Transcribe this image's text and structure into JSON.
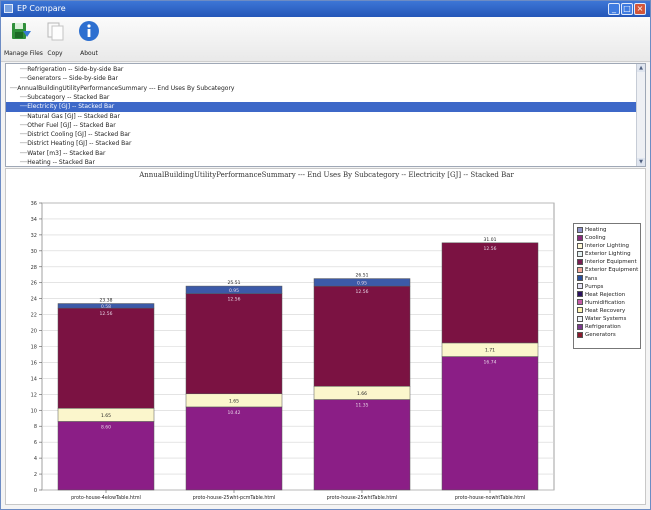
{
  "window": {
    "title": "EP Compare"
  },
  "toolbar": {
    "items": [
      {
        "label": "Manage Files",
        "icon": "manage-files-icon"
      },
      {
        "label": "Copy",
        "icon": "copy-icon"
      },
      {
        "label": "About",
        "icon": "info-icon"
      }
    ]
  },
  "tree": {
    "items": [
      {
        "text": "Refrigeration -- Side-by-side Bar",
        "indent": 2,
        "state": "normal"
      },
      {
        "text": "Generators -- Side-by-side Bar",
        "indent": 2,
        "state": "normal"
      },
      {
        "text": "AnnualBuildingUtilityPerformanceSummary --- End Uses By Subcategory",
        "indent": 1,
        "state": "normal"
      },
      {
        "text": "Subcategory -- Stacked Bar",
        "indent": 2,
        "state": "normal"
      },
      {
        "text": "Electricity [GJ] -- Stacked Bar",
        "indent": 2,
        "state": "selected"
      },
      {
        "text": "Natural Gas [GJ] -- Stacked Bar",
        "indent": 2,
        "state": "normal"
      },
      {
        "text": "Other Fuel [GJ] -- Stacked Bar",
        "indent": 2,
        "state": "normal"
      },
      {
        "text": "District Cooling [GJ] -- Stacked Bar",
        "indent": 2,
        "state": "normal"
      },
      {
        "text": "District Heating [GJ] -- Stacked Bar",
        "indent": 2,
        "state": "normal"
      },
      {
        "text": "Water [m3] -- Stacked Bar",
        "indent": 2,
        "state": "normal"
      },
      {
        "text": "Heating -- Stacked Bar",
        "indent": 2,
        "state": "normal"
      }
    ]
  },
  "chart_data": {
    "type": "bar",
    "stacked": true,
    "title": "AnnualBuildingUtilityPerformanceSummary --- End Uses By Subcategory -- Electricity [GJ] -- Stacked Bar",
    "categories": [
      "proto-house-4elowTable.html",
      "proto-house-25wht-pcmTable.html",
      "proto-house-25whtTable.html",
      "proto-house-nowhtTable.html"
    ],
    "ylim": [
      0,
      36
    ],
    "yticks": [
      0,
      2,
      4,
      6,
      8,
      10,
      12,
      14,
      16,
      18,
      20,
      22,
      24,
      26,
      28,
      30,
      32,
      34,
      36
    ],
    "grid": true,
    "legend_position": "right",
    "legend": [
      {
        "name": "Heating",
        "color": "#8f93c9"
      },
      {
        "name": "Cooling",
        "color": "#8a2a7c"
      },
      {
        "name": "Interior Lighting",
        "color": "#fff9d6"
      },
      {
        "name": "Exterior Lighting",
        "color": "#e3f1f1"
      },
      {
        "name": "Interior Equipment",
        "color": "#7a1e52"
      },
      {
        "name": "Exterior Equipment",
        "color": "#f2a79a"
      },
      {
        "name": "Fans",
        "color": "#2a4e9a"
      },
      {
        "name": "Pumps",
        "color": "#e6e4f6"
      },
      {
        "name": "Heat Rejection",
        "color": "#2b1160"
      },
      {
        "name": "Humidification",
        "color": "#c65ca6"
      },
      {
        "name": "Heat Recovery",
        "color": "#fff4b0"
      },
      {
        "name": "Water Systems",
        "color": "#f0f4fa"
      },
      {
        "name": "Refrigeration",
        "color": "#7a3a8c"
      },
      {
        "name": "Generators",
        "color": "#8a1a2e"
      }
    ],
    "series": [
      {
        "name": "Cooling",
        "color": "#8b1e86",
        "values": [
          8.6,
          10.42,
          11.35,
          16.74
        ],
        "labels": [
          "8.60",
          "10.42",
          "11.35",
          "16.74"
        ]
      },
      {
        "name": "Interior Lighting",
        "color": "#fbf6cc",
        "values": [
          1.65,
          1.65,
          1.66,
          1.71
        ],
        "labels": [
          "1.65",
          "1.65",
          "1.66",
          "1.71"
        ]
      },
      {
        "name": "Interior Equipment",
        "color": "#7b1242",
        "values": [
          12.56,
          12.56,
          12.56,
          12.56
        ],
        "labels": [
          "12.56",
          "12.56",
          "12.56",
          "12.56"
        ]
      },
      {
        "name": "Fans",
        "color": "#3c5aa8",
        "values": [
          0.58,
          0.95,
          0.95,
          0.0
        ],
        "labels": [
          "0.58",
          "0.95",
          "0.95",
          ""
        ]
      }
    ],
    "totals": [
      "23.38",
      "25.51",
      "26.51",
      "31.01"
    ]
  }
}
